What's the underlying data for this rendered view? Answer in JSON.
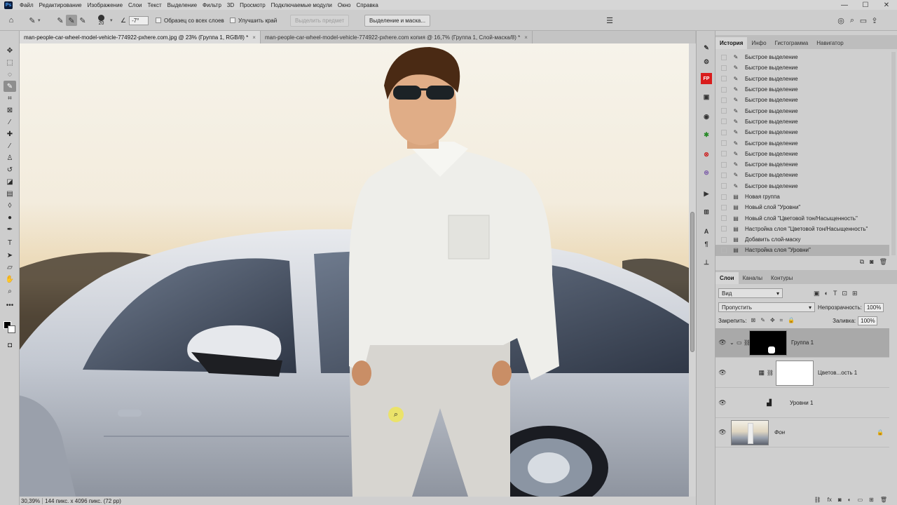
{
  "menubar": {
    "logo": "Ps",
    "items": [
      "Файл",
      "Редактирование",
      "Изображение",
      "Слои",
      "Текст",
      "Выделение",
      "Фильтр",
      "3D",
      "Просмотр",
      "Подключаемые модули",
      "Окно",
      "Справка"
    ],
    "minimize": "—",
    "maximize": "☐",
    "close": "✕"
  },
  "options": {
    "brush_size": "20",
    "angle": "-7°",
    "sample_all_layers": "Образец со всех слоев",
    "enhance_edge": "Улучшить край",
    "select_subject": "Выделить предмет",
    "select_and_mask": "Выделение и маска..."
  },
  "tabs": [
    {
      "label": "man-people-car-wheel-model-vehicle-774922-pxhere.com.jpg @ 23% (Группа 1, RGB/8) *",
      "close": "×"
    },
    {
      "label": "man-people-car-wheel-model-vehicle-774922-pxhere.com копия @ 16,7% (Группа 1, Слой-маска/8) *",
      "close": "×"
    }
  ],
  "status": {
    "zoom": "30,39%",
    "info": "144 пикс. x 4096 пикс. (72 pp)"
  },
  "history_panel": {
    "tabs": [
      "История",
      "Инфо",
      "Гистограмма",
      "Навигатор"
    ],
    "items": [
      "Быстрое выделение",
      "Быстрое выделение",
      "Быстрое выделение",
      "Быстрое выделение",
      "Быстрое выделение",
      "Быстрое выделение",
      "Быстрое выделение",
      "Быстрое выделение",
      "Быстрое выделение",
      "Быстрое выделение",
      "Быстрое выделение",
      "Быстрое выделение",
      "Быстрое выделение",
      "Новая группа",
      "Новый слой \"Уровни\"",
      "Новый слой \"Цветовой тон/Насыщенность\"",
      "Настройка слоя \"Цветовой тон/Насыщенность\"",
      "Добавить слой-маску",
      "Настройка слоя \"Уровни\""
    ]
  },
  "layers_panel": {
    "tabs": [
      "Слои",
      "Каналы",
      "Контуры"
    ],
    "filter_kind": "Вид",
    "blend_mode": "Пропустить",
    "opacity_label": "Непрозрачность:",
    "opacity_value": "100%",
    "lock_label": "Закрепить:",
    "fill_label": "Заливка:",
    "fill_value": "100%",
    "layers": [
      {
        "name": "Группа 1"
      },
      {
        "name": "Цветов...ость 1"
      },
      {
        "name": "Уровни 1"
      },
      {
        "name": "Фон"
      }
    ]
  }
}
